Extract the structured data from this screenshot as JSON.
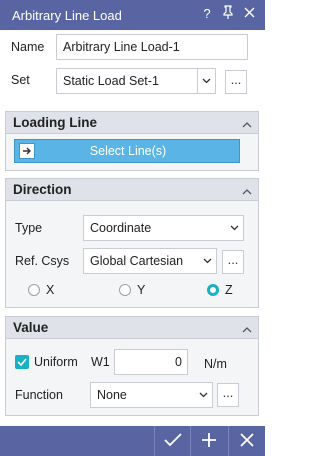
{
  "window": {
    "title": "Arbitrary Line Load"
  },
  "general": {
    "name_label": "Name",
    "name_value": "Arbitrary Line Load-1",
    "set_label": "Set",
    "set_value": "Static Load Set-1",
    "dots": "..."
  },
  "loading_line": {
    "title": "Loading Line",
    "select_button": "Select Line(s)"
  },
  "direction": {
    "title": "Direction",
    "type_label": "Type",
    "type_value": "Coordinate",
    "csys_label": "Ref. Csys",
    "csys_value": "Global Cartesian",
    "dots": "...",
    "axes": [
      {
        "label": "X",
        "selected": false
      },
      {
        "label": "Y",
        "selected": false
      },
      {
        "label": "Z",
        "selected": true
      }
    ]
  },
  "value": {
    "title": "Value",
    "uniform_label": "Uniform",
    "uniform_checked": true,
    "w1_label": "W1",
    "w1_value": "0",
    "unit": "N/m",
    "function_label": "Function",
    "function_value": "None",
    "dots": "..."
  },
  "colors": {
    "titlebar": "#5965a3",
    "accent": "#1ab0c8",
    "select_button": "#5ab4e6"
  },
  "icons": {
    "help": "question-icon",
    "pin": "pin-icon",
    "close": "close-icon",
    "confirm": "checkmark-icon",
    "add": "plus-icon",
    "cancel": "close-icon"
  }
}
